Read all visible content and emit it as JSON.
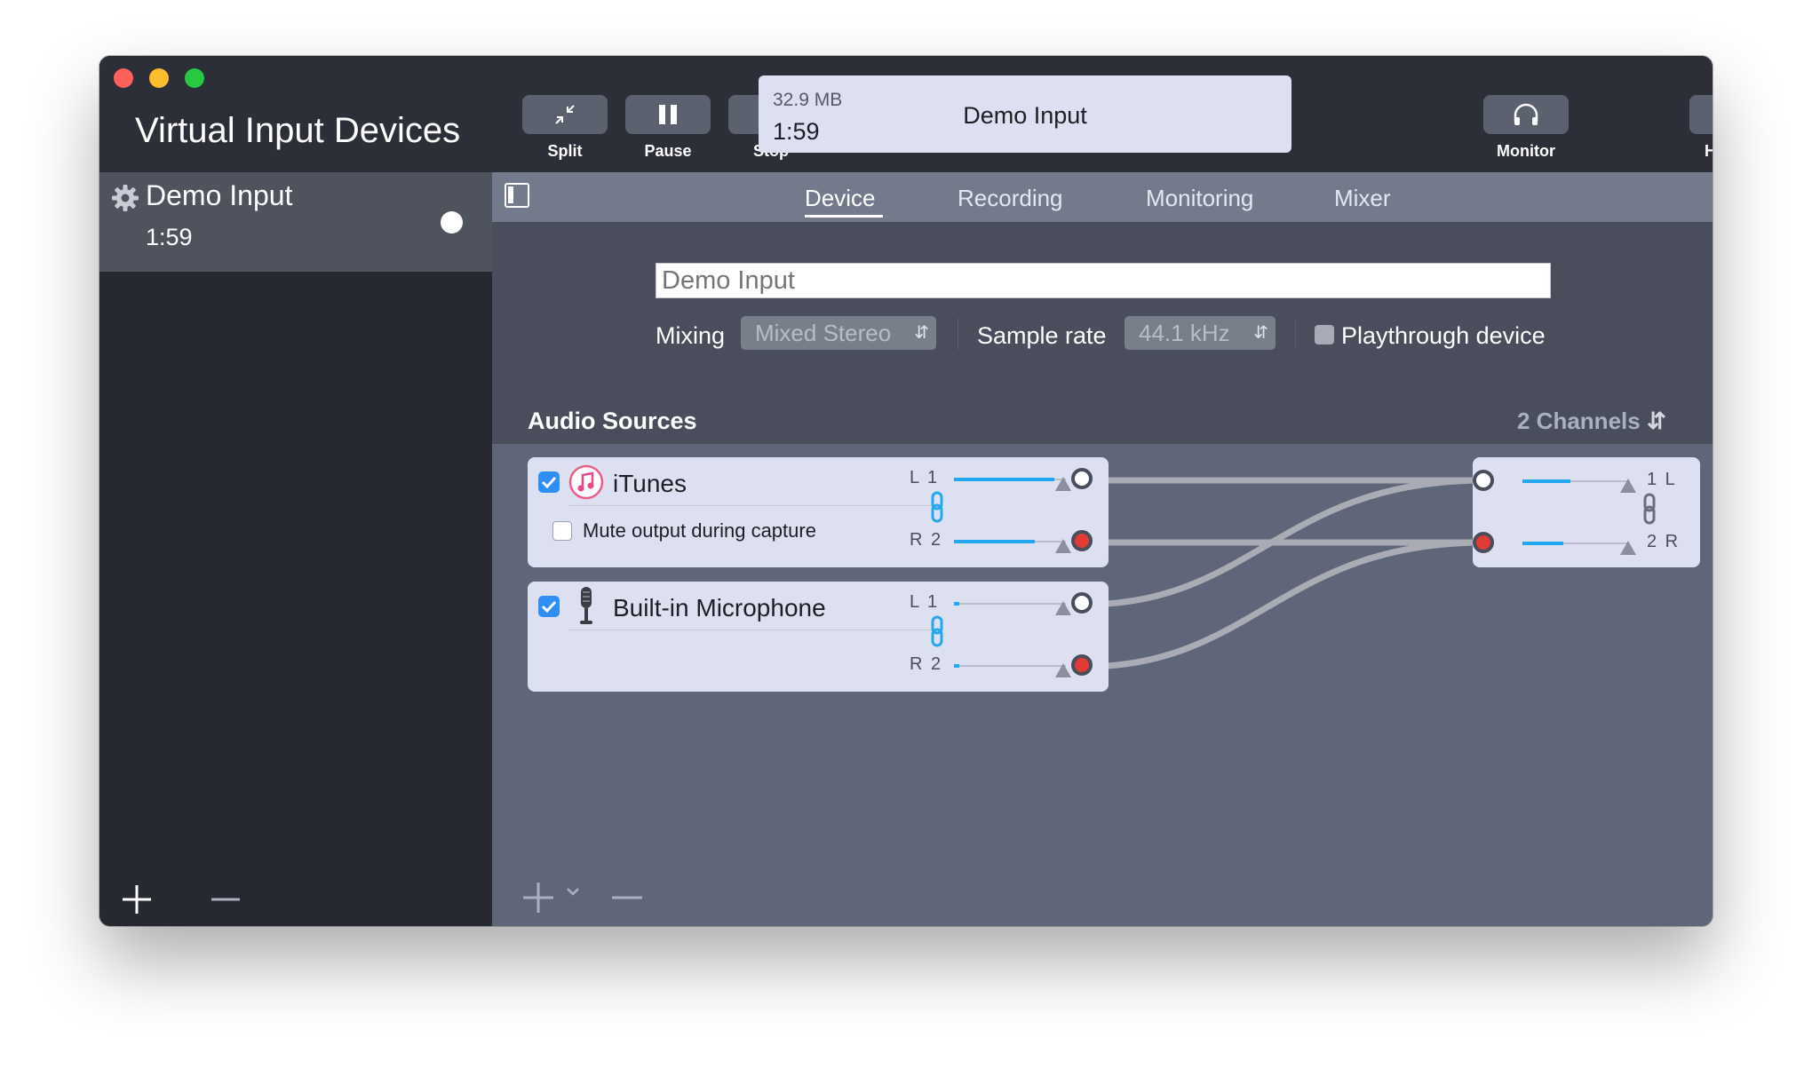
{
  "sidebar": {
    "title": "Virtual Input Devices",
    "device": {
      "name": "Demo Input",
      "time": "1:59"
    }
  },
  "toolbar": {
    "split": "Split",
    "pause": "Pause",
    "stop": "Stop",
    "monitor": "Monitor",
    "history": "History",
    "display": {
      "size": "32.9 MB",
      "time": "1:59",
      "name": "Demo Input"
    }
  },
  "tabs": {
    "device": "Device",
    "recording": "Recording",
    "monitoring": "Monitoring",
    "mixer": "Mixer"
  },
  "device": {
    "name_placeholder": "Demo Input",
    "mixing_label": "Mixing",
    "mixing_value": "Mixed Stereo",
    "sample_rate_label": "Sample rate",
    "sample_rate_value": "44.1 kHz",
    "playthrough_label": "Playthrough device"
  },
  "sources": {
    "title": "Audio Sources",
    "channels": "2 Channels",
    "items": [
      {
        "name": "iTunes",
        "option": "Mute output during capture",
        "left_label": "L 1",
        "right_label": "R 2",
        "left_level": 0.9,
        "right_level": 0.72
      },
      {
        "name": "Built-in Microphone",
        "left_label": "L 1",
        "right_label": "R 2",
        "left_level": 0.05,
        "right_level": 0.05
      }
    ],
    "output": {
      "left_label": "1 L",
      "right_label": "2 R",
      "left_level": 0.45,
      "right_level": 0.38
    }
  },
  "colors": {
    "accent": "#2f8ef4",
    "meter": "#22a8ef",
    "record": "#e23a35",
    "window_bg": "#60667a"
  }
}
